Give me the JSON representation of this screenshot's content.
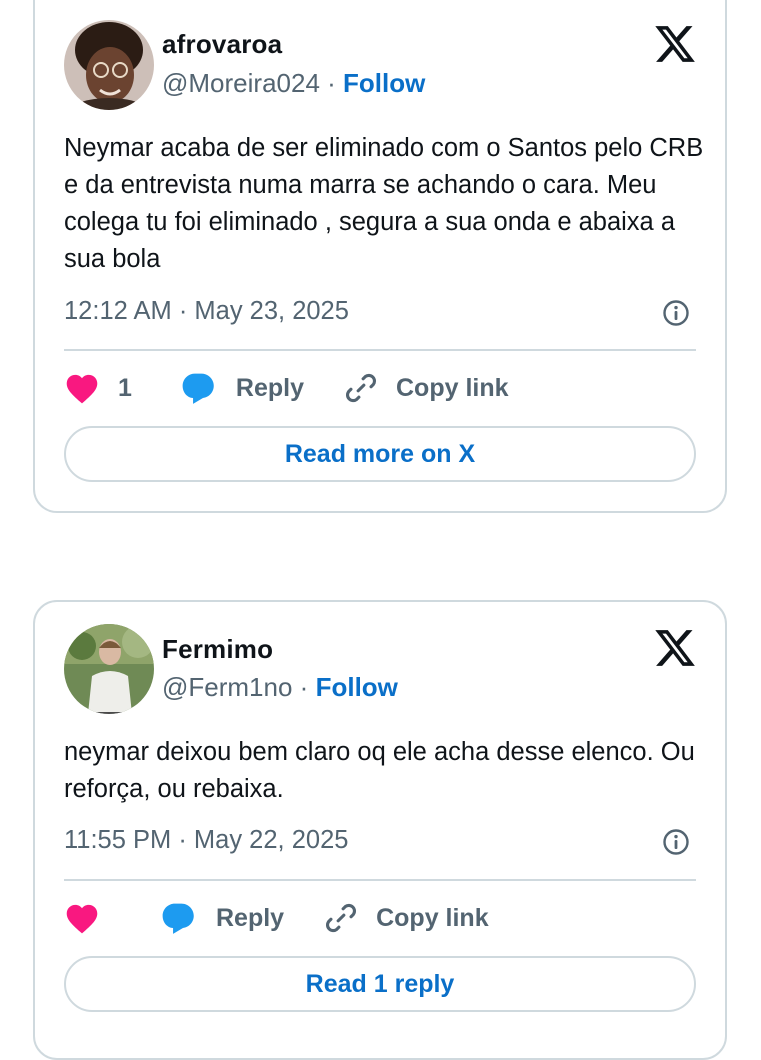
{
  "colors": {
    "accent": "#0a6fc8",
    "like": "#f91880",
    "reply": "#1d9bf0",
    "secondary_text": "#536471",
    "border": "#cfd9de"
  },
  "tweets": [
    {
      "display_name": "afrovaroa",
      "handle": "@Moreira024",
      "separator": "·",
      "follow_label": "Follow",
      "text": "Neymar acaba de ser eliminado com o Santos pelo CRB e da entrevista numa marra se achando o cara. Meu colega tu foi eliminado , segura a sua onda e abaixa a sua bola",
      "timestamp": "12:12 AM · May 23, 2025",
      "like_count": "1",
      "reply_label": "Reply",
      "copy_label": "Copy link",
      "read_label": "Read more on X",
      "icons": [
        "x-logo-icon",
        "info-icon",
        "heart-icon",
        "reply-bubble-icon",
        "link-icon"
      ]
    },
    {
      "display_name": "Fermimo",
      "handle": "@Ferm1no",
      "separator": "·",
      "follow_label": "Follow",
      "text": "neymar deixou bem claro oq ele acha desse elenco. Ou reforça, ou rebaixa.",
      "timestamp": "11:55 PM · May 22, 2025",
      "like_count": "",
      "reply_label": "Reply",
      "copy_label": "Copy link",
      "read_label": "Read 1 reply",
      "icons": [
        "x-logo-icon",
        "info-icon",
        "heart-icon",
        "reply-bubble-icon",
        "link-icon"
      ]
    }
  ]
}
